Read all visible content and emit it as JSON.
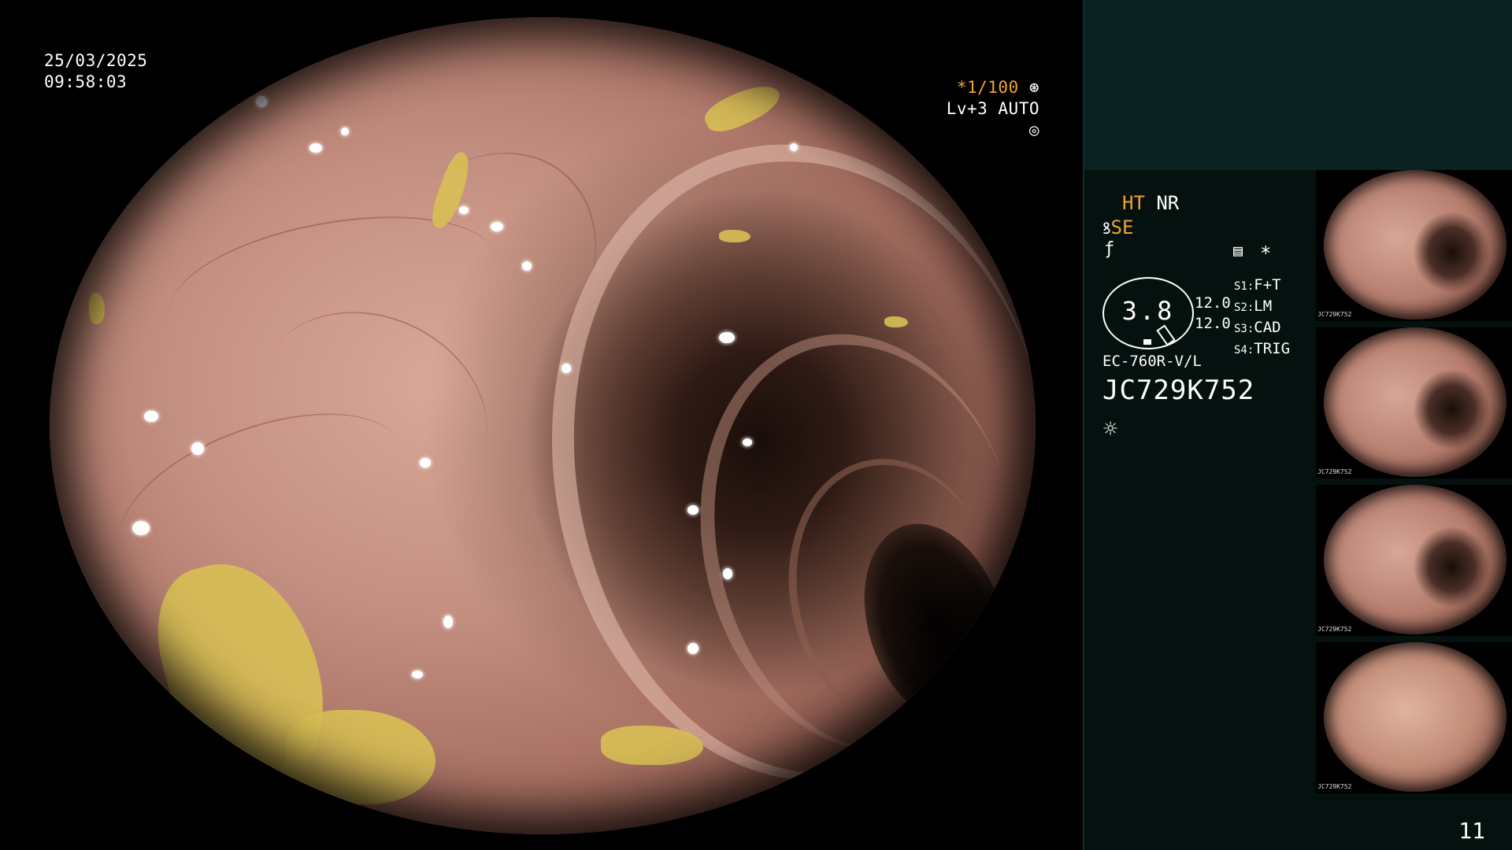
{
  "overlay": {
    "date": "25/03/2025",
    "time": "09:58:03",
    "shutter": "*1/100",
    "shutter_icon": "shutter-icon",
    "iris": "Lv+3 AUTO",
    "iris_icon": "iris-icon"
  },
  "panel": {
    "ht": "HT",
    "nr": "NR",
    "se": "SE",
    "se_icon": "enhance-curve-icon",
    "fn_icon": "function-icon",
    "memory_icon": "memory-icon",
    "star": "*",
    "gauge_value": "3.8",
    "depth_top": "12.0",
    "depth_bottom": "12.0",
    "presets": [
      {
        "key": "S1:",
        "value": "F+T"
      },
      {
        "key": "S2:",
        "value": "LM"
      },
      {
        "key": "S3:",
        "value": "CAD"
      },
      {
        "key": "S4:",
        "value": "TRIG"
      }
    ],
    "scope_model": "EC-760R-V/L",
    "serial": "JC729K752",
    "light_icon": "light-icon",
    "page_number": "11"
  },
  "thumbnails": [
    {
      "tag": "JC729K752"
    },
    {
      "tag": "JC729K752"
    },
    {
      "tag": "JC729K752"
    },
    {
      "tag": "JC729K752"
    }
  ],
  "colors": {
    "accent_orange": "#f0a331",
    "panel_bg": "#04110f",
    "panel_top_bg": "#0c2121"
  }
}
